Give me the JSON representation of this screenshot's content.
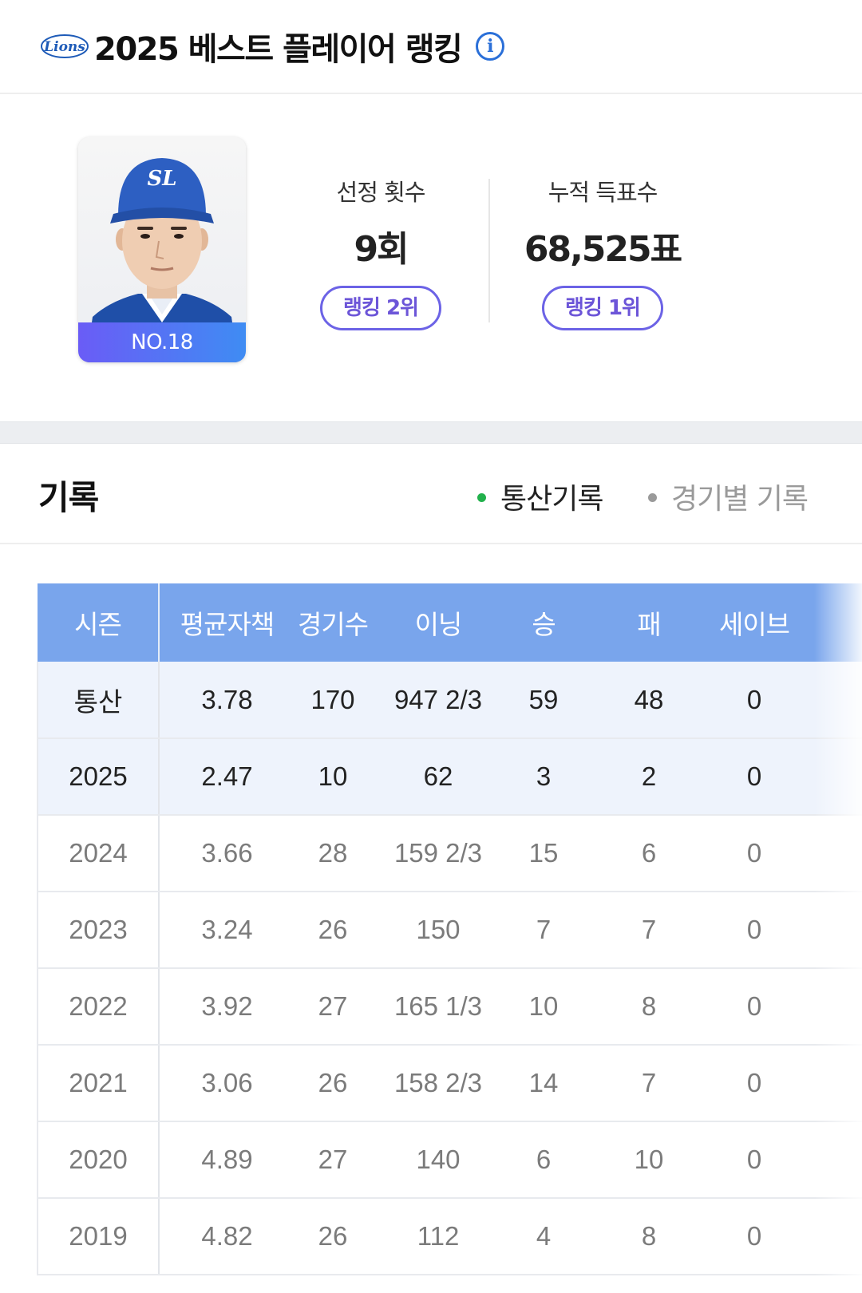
{
  "header": {
    "logo_text": "Lions",
    "title": "2025 베스트 플레이어 랭킹",
    "info_glyph": "i"
  },
  "player": {
    "cap_letters": "SL",
    "number": "NO.18"
  },
  "stats": [
    {
      "label": "선정 횟수",
      "value": "9회",
      "badge": "랭킹 2위"
    },
    {
      "label": "누적 득표수",
      "value": "68,525표",
      "badge": "랭킹 1위"
    }
  ],
  "records": {
    "title": "기록",
    "tabs": [
      {
        "label": "통산기록",
        "active": true
      },
      {
        "label": "경기별 기록",
        "active": false
      }
    ],
    "columns": [
      "시즌",
      "평균자책",
      "경기수",
      "이닝",
      "승",
      "패",
      "세이브"
    ],
    "rows": [
      {
        "season": "통산",
        "era": "3.78",
        "games": "170",
        "innings": "947 2/3",
        "wins": "59",
        "losses": "48",
        "saves": "0",
        "highlight": true
      },
      {
        "season": "2025",
        "era": "2.47",
        "games": "10",
        "innings": "62",
        "wins": "3",
        "losses": "2",
        "saves": "0",
        "highlight": true
      },
      {
        "season": "2024",
        "era": "3.66",
        "games": "28",
        "innings": "159 2/3",
        "wins": "15",
        "losses": "6",
        "saves": "0",
        "highlight": false
      },
      {
        "season": "2023",
        "era": "3.24",
        "games": "26",
        "innings": "150",
        "wins": "7",
        "losses": "7",
        "saves": "0",
        "highlight": false
      },
      {
        "season": "2022",
        "era": "3.92",
        "games": "27",
        "innings": "165 1/3",
        "wins": "10",
        "losses": "8",
        "saves": "0",
        "highlight": false
      },
      {
        "season": "2021",
        "era": "3.06",
        "games": "26",
        "innings": "158 2/3",
        "wins": "14",
        "losses": "7",
        "saves": "0",
        "highlight": false
      },
      {
        "season": "2020",
        "era": "4.89",
        "games": "27",
        "innings": "140",
        "wins": "6",
        "losses": "10",
        "saves": "0",
        "highlight": false
      },
      {
        "season": "2019",
        "era": "4.82",
        "games": "26",
        "innings": "112",
        "wins": "4",
        "losses": "8",
        "saves": "0",
        "highlight": false
      }
    ]
  },
  "colors": {
    "brand_blue": "#2a6fd8",
    "table_header": "#79a5ec",
    "badge_purple": "#6c55d8",
    "active_dot": "#22b14c"
  }
}
